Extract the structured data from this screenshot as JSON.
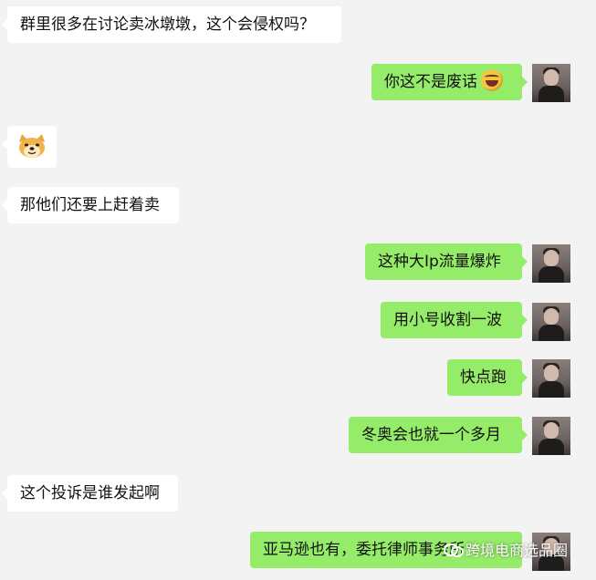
{
  "messages": [
    {
      "side": "left",
      "text": "群里很多在讨论卖冰墩墩，这个会侵权吗？"
    },
    {
      "side": "right",
      "text": "你这不是废话"
    },
    {
      "side": "left",
      "sticker": "doge-icon"
    },
    {
      "side": "left",
      "text": "那他们还要上赶着卖"
    },
    {
      "side": "right",
      "text": "这种大Ip流量爆炸"
    },
    {
      "side": "right",
      "text": "用小号收割一波"
    },
    {
      "side": "right",
      "text": "快点跑"
    },
    {
      "side": "right",
      "text": "冬奥会也就一个多月"
    },
    {
      "side": "left",
      "text": "这个投诉是谁发起啊"
    },
    {
      "side": "right",
      "text": "亚马逊也有，委托律师事务所"
    }
  ],
  "watermark": {
    "text": "跨境电商选品圈"
  },
  "colors": {
    "background": "#f3f3f3",
    "incoming_bubble": "#ffffff",
    "outgoing_bubble": "#95ec69"
  },
  "icons": {
    "laugh_emoji": "face-with-tears-of-joy-icon",
    "sticker": "doge-icon",
    "watermark": "wechat-icon"
  }
}
